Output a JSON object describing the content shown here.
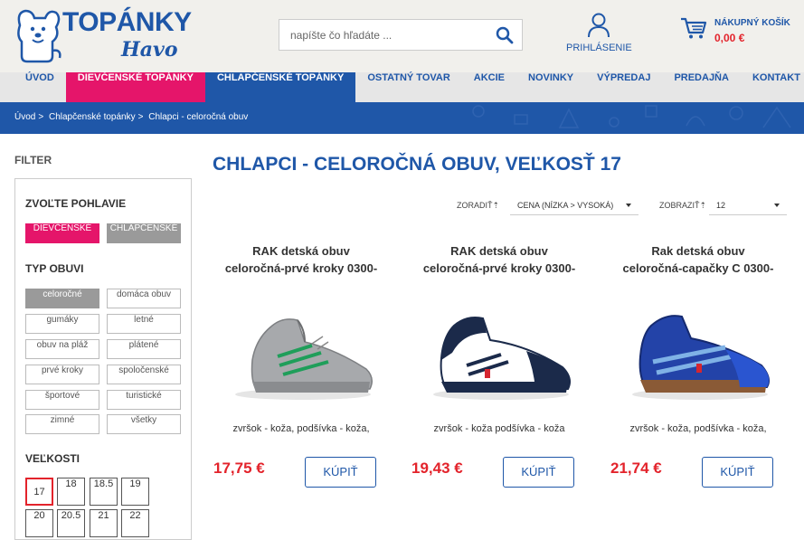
{
  "header": {
    "logo_text": "TOPÁNKY",
    "logo_sub": "Havo",
    "search_placeholder": "napíšte čo hľadáte ...",
    "login_label": "PRIHLÁSENIE",
    "cart_title": "NÁKUPNÝ KOŠÍK",
    "cart_price": "0,00 €"
  },
  "nav": [
    {
      "label": "ÚVOD",
      "state": "normal"
    },
    {
      "label": "DIEVČENSKÉ TOPÁNKY",
      "state": "pink"
    },
    {
      "label": "CHLAPČENSKÉ TOPÁNKY",
      "state": "blue"
    },
    {
      "label": "OSTATNÝ TOVAR",
      "state": "normal"
    },
    {
      "label": "AKCIE",
      "state": "normal"
    },
    {
      "label": "NOVINKY",
      "state": "normal"
    },
    {
      "label": "VÝPREDAJ",
      "state": "normal"
    },
    {
      "label": "PREDAJŇA",
      "state": "normal"
    },
    {
      "label": "KONTAKT",
      "state": "normal"
    }
  ],
  "breadcrumb": [
    "Úvod",
    "Chlapčenské topánky",
    "Chlapci - celoročná obuv"
  ],
  "sidebar": {
    "heading": "FILTER",
    "gender_title": "ZVOĽTE POHLAVIE",
    "gender_girls": "DIEVČENSKÉ",
    "gender_boys": "CHLAPČENSKÉ",
    "type_title": "TYP OBUVI",
    "types": [
      "celoročné",
      "domáca obuv",
      "gumáky",
      "letné",
      "obuv na pláž",
      "plátené",
      "prvé kroky",
      "spoločenské",
      "športové",
      "turistické",
      "zimné",
      "všetky"
    ],
    "sizes_title": "VEĽKOSTI",
    "sizes": [
      "17",
      "18",
      "18.5",
      "19",
      "20",
      "20.5",
      "21",
      "22"
    ]
  },
  "main": {
    "title": "CHLAPCI - CELOROČNÁ OBUV, VEĽKOSŤ 17",
    "sort_label": "ZORADIŤ",
    "sort_value": "CENA (NÍZKA > VYSOKÁ)",
    "show_label": "ZOBRAZIŤ",
    "show_value": "12",
    "buy_label": "KÚPIŤ"
  },
  "products": [
    {
      "name_1": "RAK detská obuv",
      "name_2": "celoročná-prvé kroky 0300-",
      "desc": "zvršok - koža, podšívka - koža,",
      "price": "17,75 €"
    },
    {
      "name_1": "RAK detská obuv",
      "name_2": "celoročná-prvé kroky 0300-",
      "desc": "zvršok - koža podšívka - koža",
      "price": "19,43 €"
    },
    {
      "name_1": "Rak detská obuv",
      "name_2": "celoročná-capačky C 0300-",
      "desc": "zvršok - koža, podšívka - koža,",
      "price": "21,74 €"
    }
  ],
  "colors": {
    "brand_blue": "#1f57a8",
    "pink": "#e5156a",
    "price_red": "#e3232b"
  }
}
